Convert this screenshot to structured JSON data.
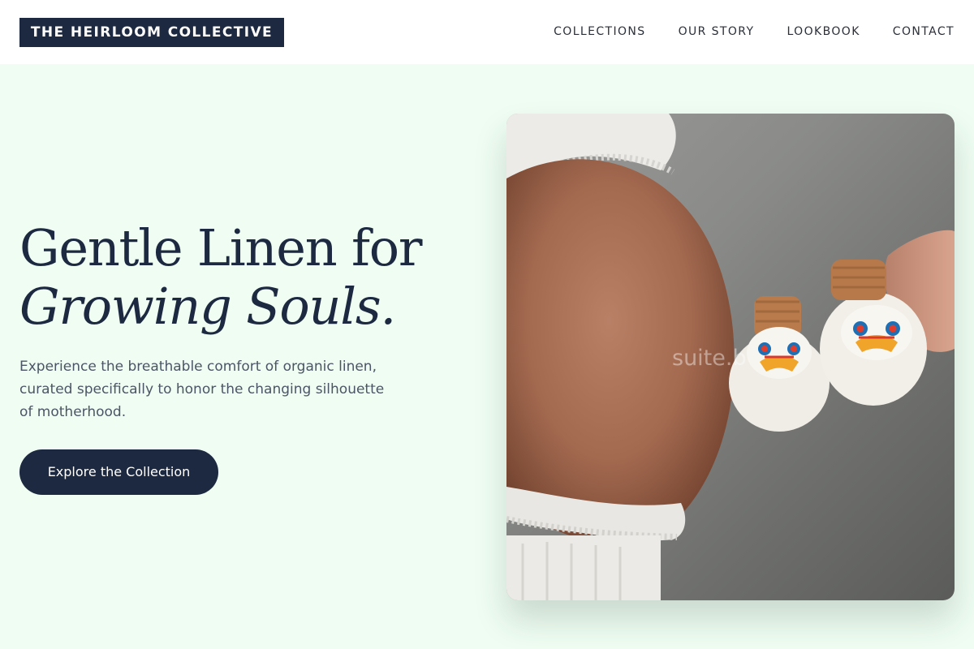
{
  "header": {
    "brand": "THE HEIRLOOM COLLECTIVE",
    "nav": [
      "COLLECTIONS",
      "OUR STORY",
      "LOOKBOOK",
      "CONTACT"
    ]
  },
  "hero": {
    "title_line1": "Gentle Linen for",
    "title_line2": "Growing Souls.",
    "subtitle": "Experience the breathable comfort of organic linen, curated specifically to honor the changing silhouette of motherhood.",
    "cta_label": "Explore the Collection"
  },
  "image": {
    "watermark": "suite.b"
  },
  "colors": {
    "page_background": "#effdf2",
    "header_background": "#ffffff",
    "accent_navy": "#1d2940",
    "body_text": "#4b5566"
  }
}
